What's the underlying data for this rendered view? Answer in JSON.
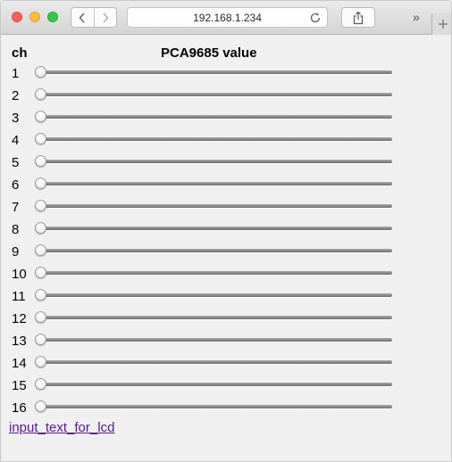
{
  "browser": {
    "address": "192.168.1.234",
    "overflow_label": "»"
  },
  "table": {
    "header_channel": "ch",
    "header_value": "PCA9685 value",
    "slider_min": 0,
    "slider_max": 4095,
    "channels": [
      {
        "label": "1",
        "value": 0
      },
      {
        "label": "2",
        "value": 0
      },
      {
        "label": "3",
        "value": 0
      },
      {
        "label": "4",
        "value": 0
      },
      {
        "label": "5",
        "value": 0
      },
      {
        "label": "6",
        "value": 0
      },
      {
        "label": "7",
        "value": 0
      },
      {
        "label": "8",
        "value": 0
      },
      {
        "label": "9",
        "value": 0
      },
      {
        "label": "10",
        "value": 0
      },
      {
        "label": "11",
        "value": 0
      },
      {
        "label": "12",
        "value": 0
      },
      {
        "label": "13",
        "value": 0
      },
      {
        "label": "14",
        "value": 0
      },
      {
        "label": "15",
        "value": 0
      },
      {
        "label": "16",
        "value": 0
      }
    ]
  },
  "link_text": "input_text_for_lcd",
  "colors": {
    "link": "#551a8b",
    "close": "#fc605c",
    "minimize": "#fdbc40",
    "zoom": "#34c84a"
  }
}
